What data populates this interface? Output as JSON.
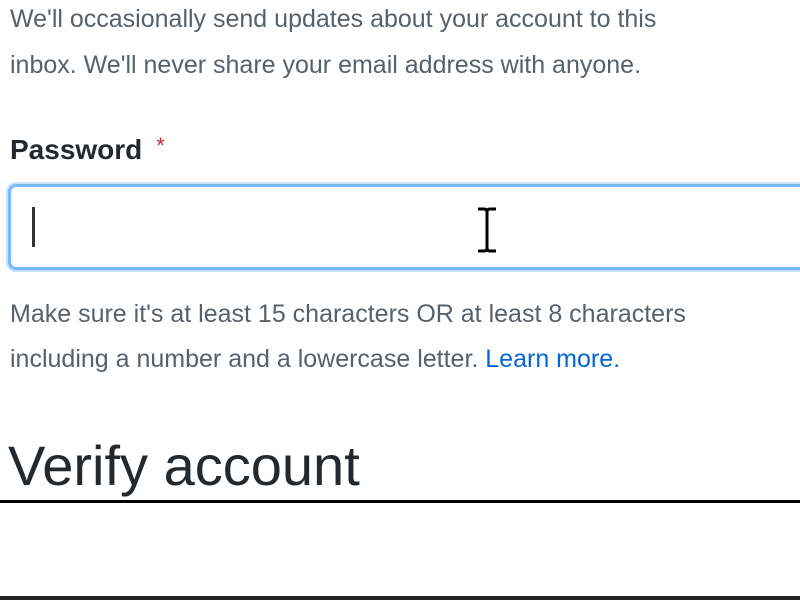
{
  "email_note": {
    "line1": "We'll occasionally send updates about your account to this",
    "line2": "inbox. We'll never share your email address with anyone."
  },
  "password": {
    "label": "Password",
    "required_marker": "*",
    "value": "",
    "placeholder": "",
    "hint_line1": "Make sure it's at least 15 characters OR at least 8 characters",
    "hint_line2_prefix": "including a number and a lowercase letter. ",
    "learn_more": "Learn more."
  },
  "verify": {
    "heading": "Verify account"
  },
  "colors": {
    "focus_border": "#79b8ff",
    "link": "#0366d6",
    "required": "#cb2431",
    "muted_text": "#586069"
  },
  "icons": {
    "cursor": "ibeam-icon"
  }
}
